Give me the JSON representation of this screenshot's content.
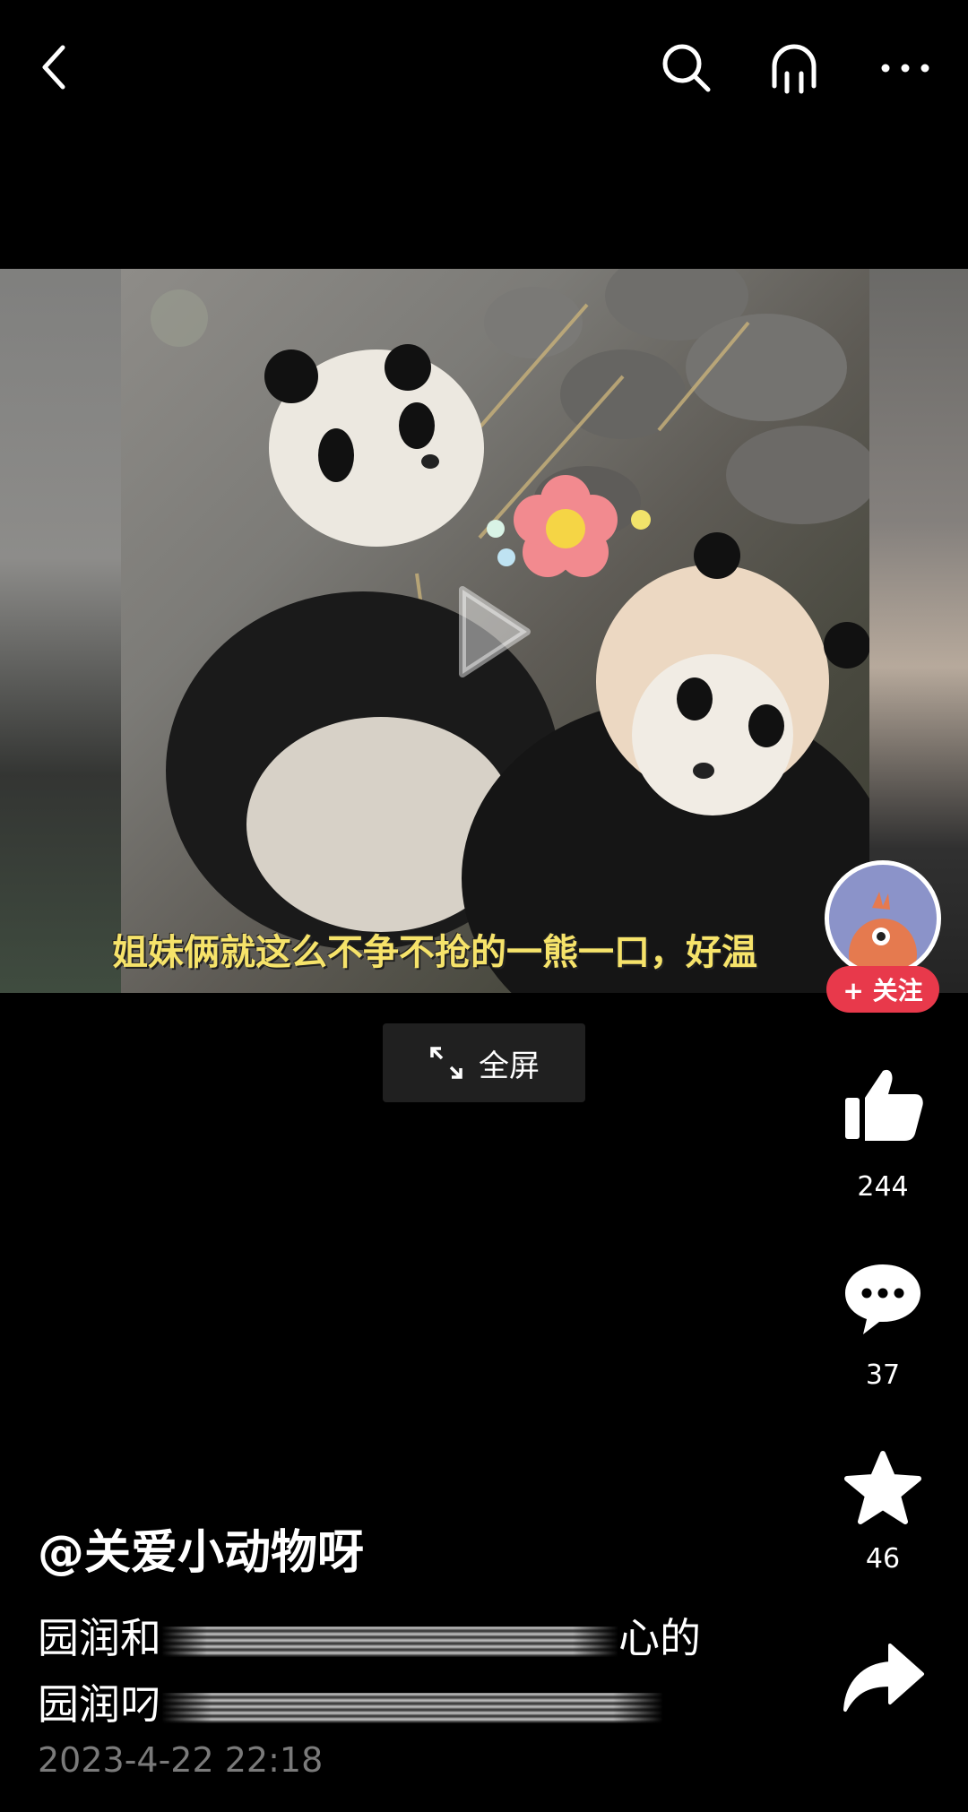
{
  "header": {
    "back_icon": "chevron-left-icon",
    "search_icon": "search-icon",
    "headphones_icon": "headphones-icon",
    "more_icon": "more-horizontal-icon"
  },
  "video": {
    "subtitle": "姐妹俩就这么不争不抢的一熊一口，好温",
    "play_icon": "play-icon",
    "fullscreen_label": "全屏"
  },
  "creator": {
    "follow_label": "+ 关注"
  },
  "actions": {
    "likes": "244",
    "comments": "37",
    "favorites": "46"
  },
  "post": {
    "author": "@关爱小动物呀",
    "line1_start": "园润和",
    "line1_end": "心的",
    "line2_start": "园润叼",
    "timestamp": "2023-4-22 22:18"
  },
  "colors": {
    "background": "#000000",
    "follow_button": "#e8394b",
    "subtitle": "#f6e36a",
    "timestamp": "#7a7a7a"
  }
}
